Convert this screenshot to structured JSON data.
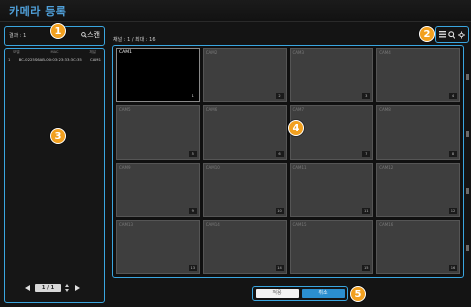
{
  "window": {
    "title": "카메라 등록"
  },
  "search": {
    "result_label": "결과 : 1",
    "scan_label": "스캔"
  },
  "device_list": {
    "headers": [
      "모델",
      "MAC",
      "채널"
    ],
    "rows": [
      {
        "index": "1",
        "mac": "BC-0225S6AB-00:03:23:33:3C:35",
        "channel": "CAM1"
      }
    ]
  },
  "pagination": {
    "current": "1 / 1"
  },
  "channel_info": "채널 : 1 / 최대 : 16",
  "cameras": [
    {
      "name": "CAM1",
      "num": "1",
      "active": true
    },
    {
      "name": "CAM2",
      "num": "2",
      "active": false
    },
    {
      "name": "CAM3",
      "num": "3",
      "active": false
    },
    {
      "name": "CAM4",
      "num": "4",
      "active": false
    },
    {
      "name": "CAM5",
      "num": "5",
      "active": false
    },
    {
      "name": "CAM6",
      "num": "6",
      "active": false
    },
    {
      "name": "CAM7",
      "num": "7",
      "active": false
    },
    {
      "name": "CAM8",
      "num": "8",
      "active": false
    },
    {
      "name": "CAM9",
      "num": "9",
      "active": false
    },
    {
      "name": "CAM10",
      "num": "10",
      "active": false
    },
    {
      "name": "CAM11",
      "num": "11",
      "active": false
    },
    {
      "name": "CAM12",
      "num": "12",
      "active": false
    },
    {
      "name": "CAM13",
      "num": "13",
      "active": false
    },
    {
      "name": "CAM14",
      "num": "14",
      "active": false
    },
    {
      "name": "CAM15",
      "num": "15",
      "active": false
    },
    {
      "name": "CAM16",
      "num": "16",
      "active": false
    }
  ],
  "toolbar": {
    "icons": [
      "list-icon",
      "search-icon",
      "settings-icon"
    ]
  },
  "buttons": {
    "apply": "적용",
    "cancel": "취소"
  },
  "callouts": [
    "1",
    "2",
    "3",
    "4",
    "5"
  ],
  "colors": {
    "accent": "#3aa6e0",
    "title": "#4f9fd8",
    "callout": "#f2a01f"
  }
}
